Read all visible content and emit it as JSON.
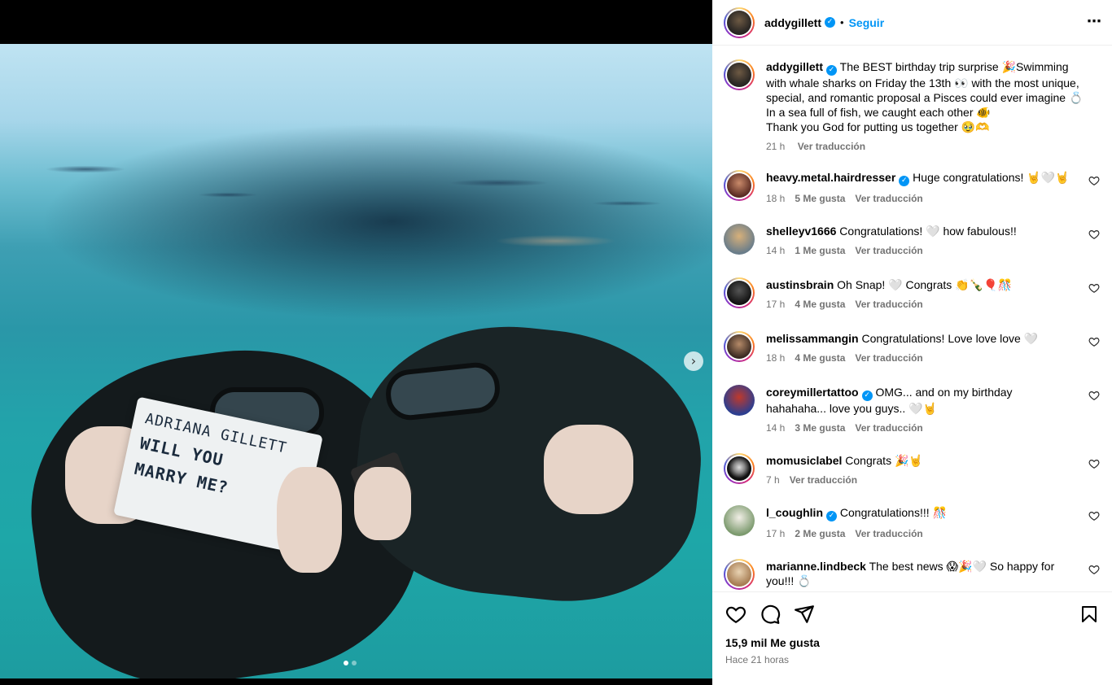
{
  "post": {
    "username": "addygillett",
    "follow_label": "Seguir",
    "separator": "•",
    "more_label": "⋯",
    "sign": {
      "line1": "ADRIANA GILLETT",
      "line2": "WILL YOU",
      "line3": "MARRY ME?"
    },
    "carousel_next": "›",
    "caption": {
      "username": "addygillett",
      "lines": [
        "The BEST birthday trip surprise 🎉Swimming with whale sharks on Friday the 13th 👀 with the most unique, special, and romantic proposal a Pisces could ever imagine 💍",
        "In a sea full of fish, we caught each other 🐠",
        "Thank you God for putting us together 🥹🫶"
      ],
      "time": "21 h",
      "translate": "Ver traducción"
    },
    "comments": [
      {
        "username": "heavy.metal.hairdresser",
        "verified": true,
        "text": "Huge congratulations! 🤘🤍🤘",
        "time": "18 h",
        "likes": "5 Me gusta",
        "translate": "Ver traducción"
      },
      {
        "username": "shelleyv1666",
        "verified": false,
        "text": "Congratulations! 🤍 how fabulous!!",
        "time": "14 h",
        "likes": "1 Me gusta",
        "translate": "Ver traducción"
      },
      {
        "username": "austinsbrain",
        "verified": false,
        "text": "Oh Snap! 🤍 Congrats 👏🍾🎈🎊",
        "time": "17 h",
        "likes": "4 Me gusta",
        "translate": "Ver traducción"
      },
      {
        "username": "melissammangin",
        "verified": false,
        "text": "Congratulations! Love love love 🤍",
        "time": "18 h",
        "likes": "4 Me gusta",
        "translate": "Ver traducción"
      },
      {
        "username": "coreymillertattoo",
        "verified": true,
        "text": "OMG... and on my birthday hahahaha... love you guys.. 🤍🤘",
        "time": "14 h",
        "likes": "3 Me gusta",
        "translate": "Ver traducción"
      },
      {
        "username": "momusiclabel",
        "verified": false,
        "text": "Congrats 🎉🤘",
        "time": "7 h",
        "likes": "",
        "translate": "Ver traducción"
      },
      {
        "username": "l_coughlin",
        "verified": true,
        "text": "Congratulations!!! 🎊",
        "time": "17 h",
        "likes": "2 Me gusta",
        "translate": "Ver traducción"
      },
      {
        "username": "marianne.lindbeck",
        "verified": false,
        "text": "The best news 😱🎉🤍 So happy for you!!! 💍",
        "time": "",
        "likes": "",
        "translate": ""
      }
    ],
    "likes_total": "15,9 mil Me gusta",
    "posted": "Hace 21 horas"
  },
  "colors": {
    "accent": "#0095f6",
    "muted": "#737373",
    "divider": "#efefef"
  },
  "icons": [
    "heart-icon",
    "comment-icon",
    "share-icon",
    "bookmark-icon",
    "more-icon",
    "verified-icon",
    "chevron-right-icon"
  ]
}
